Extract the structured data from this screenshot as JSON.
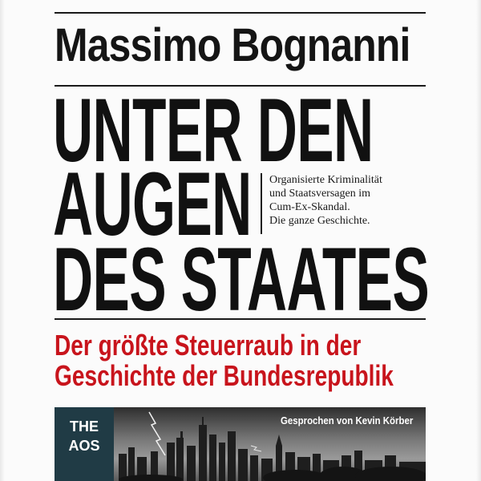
{
  "cover": {
    "author": "Massimo Bognanni",
    "title_lines": [
      "UNTER DEN",
      "AUGEN",
      "DES STAATES"
    ],
    "tagline_lines": [
      "Organisierte Kriminalität",
      "und Staatsversagen im",
      "Cum-Ex-Skandal.",
      "Die ganze Geschichte."
    ],
    "subtitle_lines": [
      "Der größte Steuerraub in der",
      "Geschichte der Bundesrepublik"
    ],
    "publisher_lines": [
      "THE",
      "AOS"
    ],
    "narrator": "Gesprochen von Kevin Körber",
    "colors": {
      "text": "#151515",
      "accent": "#c8141c",
      "publisher_bg": "#203b45"
    },
    "image": "city-skyline-with-lightning"
  }
}
